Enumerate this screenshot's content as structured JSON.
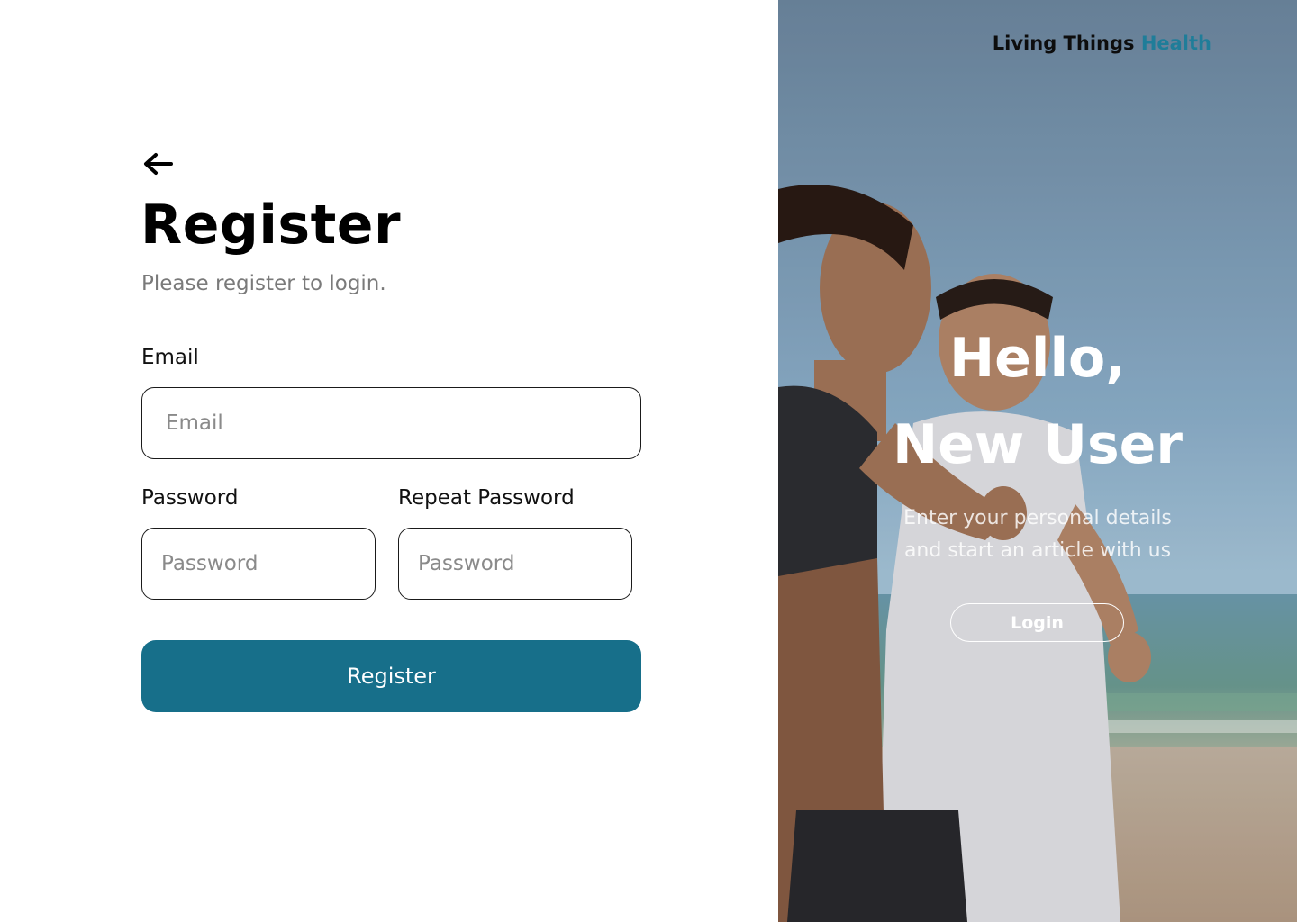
{
  "register": {
    "back_icon": "arrow-left-icon",
    "title": "Register",
    "subtitle": "Please register to login.",
    "email_label": "Email",
    "email_placeholder": "Email",
    "password_label": "Password",
    "password_placeholder": "Password",
    "repeat_password_label": "Repeat Password",
    "repeat_password_placeholder": "Password",
    "submit_label": "Register",
    "accent_color": "#176f8a"
  },
  "hero": {
    "brand_primary": "Living Things",
    "brand_accent": "Health",
    "greeting_line1": "Hello,",
    "greeting_line2": "New User",
    "tagline_line1": "Enter your personal details",
    "tagline_line2": "and start an article with us",
    "login_label": "Login",
    "brand_accent_color": "#1f7d99"
  }
}
